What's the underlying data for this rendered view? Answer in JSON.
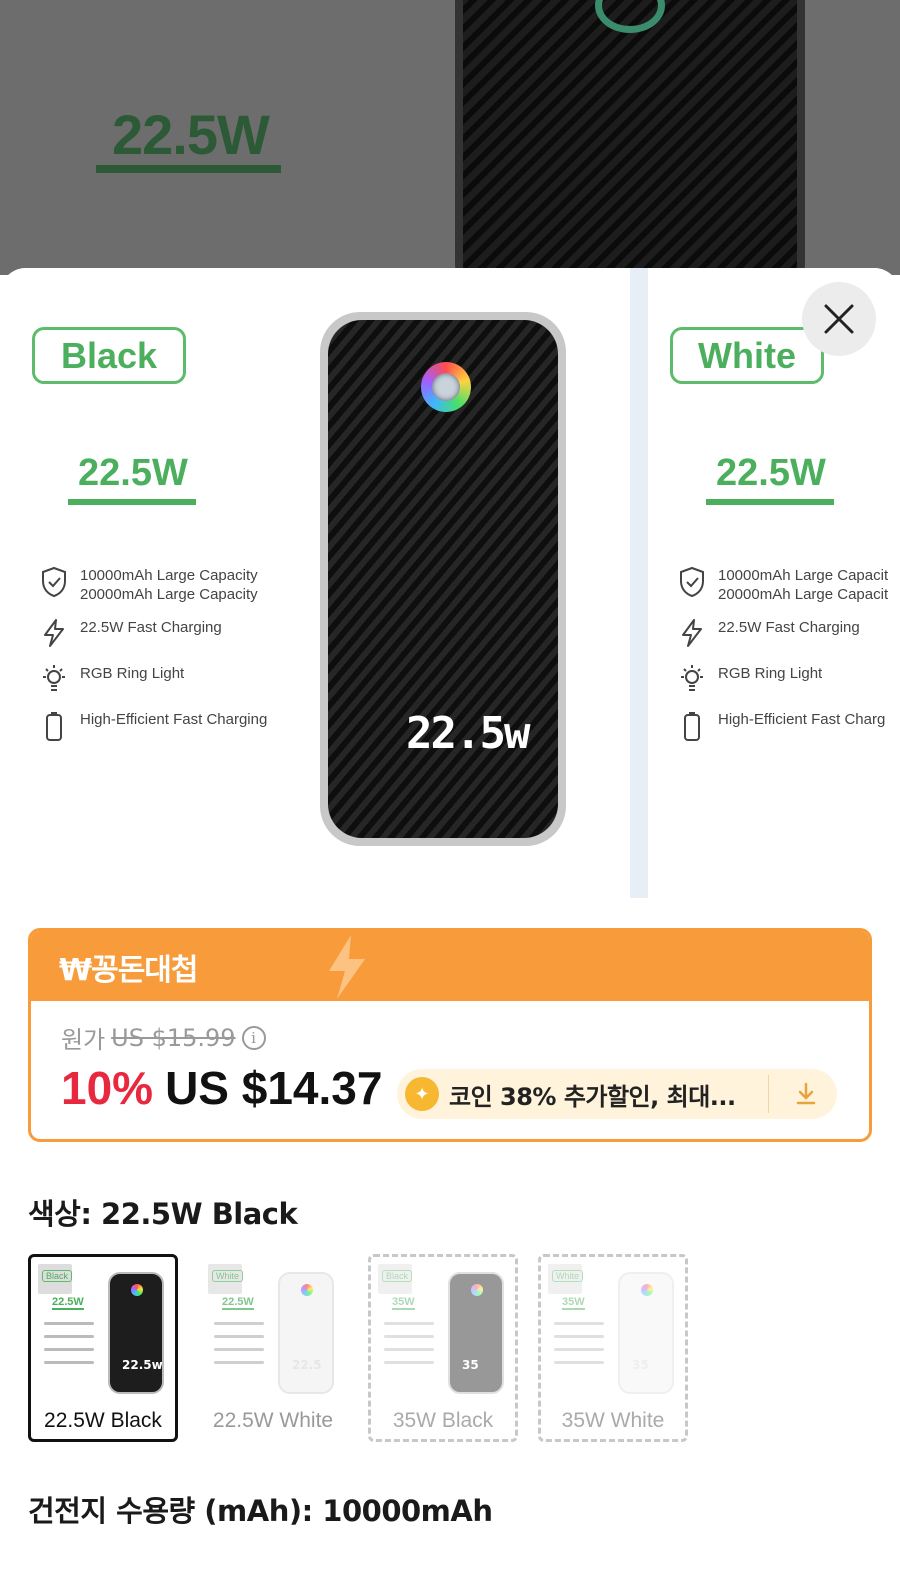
{
  "background": {
    "watt": "22.5W"
  },
  "hero": {
    "panels": [
      {
        "color_tag": "Black",
        "watt": "22.5W",
        "features": [
          "10000mAh Large Capacity",
          "20000mAh Large Capacity",
          "22.5W Fast Charging",
          "RGB Ring Light",
          "High-Efficient Fast Charging"
        ],
        "display": "22.5w"
      },
      {
        "color_tag": "White",
        "watt": "22.5W",
        "features": [
          "10000mAh Large Capacit",
          "20000mAh Large Capacit",
          "22.5W Fast Charging",
          "RGB Ring Light",
          "High-Efficient Fast Charg"
        ]
      }
    ],
    "close_icon": "close-icon"
  },
  "promo": {
    "title": "₩꽁돈대첩",
    "original_label": "원가",
    "original_price": "US $15.99",
    "discount": "10%",
    "price": "US $14.37",
    "coin_text": "코인 38% 추가할인, 최대...",
    "colors": {
      "accent": "#f89b3a",
      "discount": "#e8283f"
    }
  },
  "color_section": {
    "title": "색상: 22.5W Black",
    "options": [
      {
        "label": "22.5W Black",
        "tag": "Black",
        "watt": "22.5W",
        "num": "22.5w",
        "selected": true
      },
      {
        "label": "22.5W White",
        "tag": "White",
        "watt": "22.5W",
        "num": "22.5",
        "selected": false
      },
      {
        "label": "35W Black",
        "tag": "Black",
        "watt": "35W",
        "num": "35",
        "selected": false
      },
      {
        "label": "35W White",
        "tag": "White",
        "watt": "35W",
        "num": "35",
        "selected": false
      }
    ]
  },
  "capacity_section": {
    "title": "건전지 수용량 (mAh): 10000mAh"
  }
}
